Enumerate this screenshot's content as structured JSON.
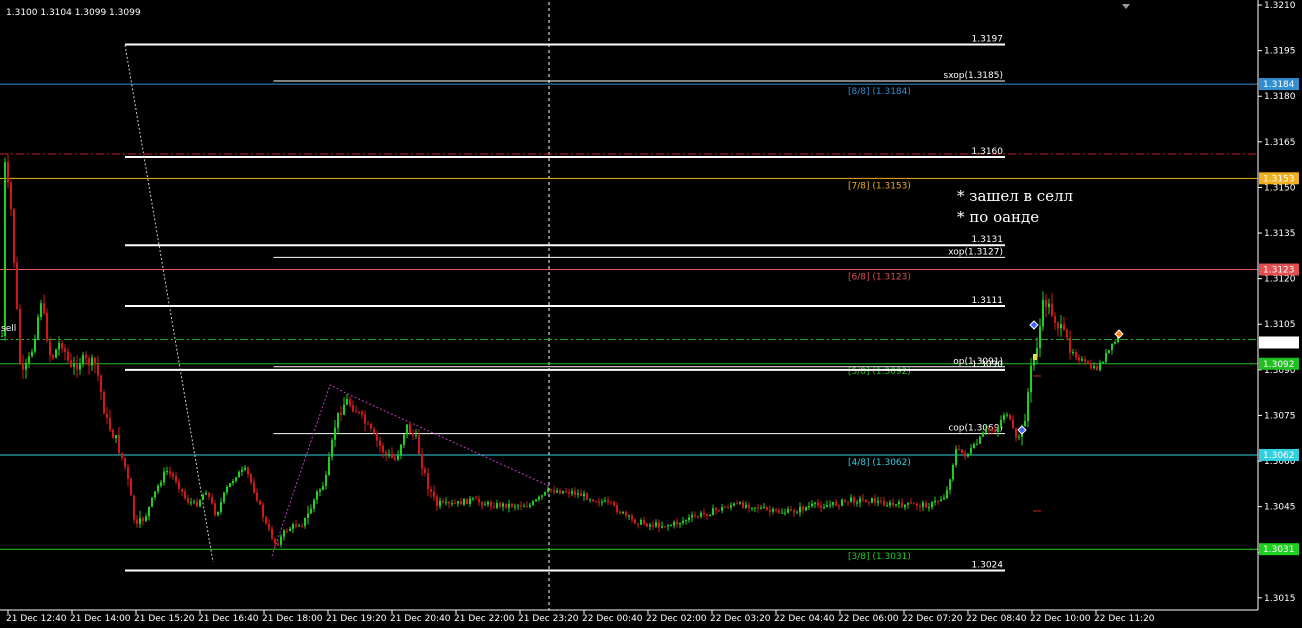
{
  "header": {
    "ohlc": "1.3100 1.3104 1.3099 1.3099"
  },
  "sell_label": "sell",
  "note": {
    "line1": "* зашел в селл",
    "line2": "* по оанде"
  },
  "price_axis": {
    "min": 1.3011,
    "max": 1.3211,
    "ticks": [
      "1.3210",
      "1.3195",
      "1.3180",
      "1.3165",
      "1.3150",
      "1.3135",
      "1.3120",
      "1.3105",
      "1.3090",
      "1.3075",
      "1.3060",
      "1.3045",
      "1.3030",
      "1.3015"
    ],
    "tick_values": [
      1.321,
      1.3195,
      1.318,
      1.3165,
      1.315,
      1.3135,
      1.312,
      1.3105,
      1.309,
      1.3075,
      1.306,
      1.3045,
      1.303,
      1.3015
    ]
  },
  "time_axis": {
    "labels": [
      "21 Dec 12:40",
      "21 Dec 14:00",
      "21 Dec 15:20",
      "21 Dec 16:40",
      "21 Dec 18:00",
      "21 Dec 19:20",
      "21 Dec 20:40",
      "21 Dec 22:00",
      "21 Dec 23:20",
      "22 Dec 00:40",
      "22 Dec 02:00",
      "22 Dec 03:20",
      "22 Dec 04:40",
      "22 Dec 06:00",
      "22 Dec 07:20",
      "22 Dec 08:40",
      "22 Dec 10:00",
      "22 Dec 11:20"
    ]
  },
  "murrey_levels": [
    {
      "id": "8-8",
      "label": "[8/8]  (1.3184)",
      "price": 1.3184,
      "color": "#2f8fd0",
      "badge": "1.3184",
      "badge_text_color": "#000000"
    },
    {
      "id": "7-8",
      "label": "[7/8]  (1.3153)",
      "price": 1.3153,
      "color": "#f0b020",
      "badge": "1.3153",
      "badge_text_color": "#000000"
    },
    {
      "id": "6-8",
      "label": "[6/8]  (1.3123)",
      "price": 1.3123,
      "color": "#e05050",
      "badge": "1.3123",
      "badge_text_color": "#ffffff"
    },
    {
      "id": "5-8",
      "label": "[5/8]  (1.3092)",
      "price": 1.3092,
      "color": "#20c020",
      "badge": "1.3092",
      "badge_text_color": "#000000"
    },
    {
      "id": "4-8",
      "label": "[4/8]  (1.3062)",
      "price": 1.3062,
      "color": "#30d0e0",
      "badge": "1.3062",
      "badge_text_color": "#000000"
    },
    {
      "id": "3-8",
      "label": "[3/8]  (1.3031)",
      "price": 1.3031,
      "color": "#20d020",
      "badge": "1.3031",
      "badge_text_color": "#000000"
    }
  ],
  "white_levels": [
    {
      "label": "1.3197",
      "price": 1.3197,
      "start": 0.096,
      "thick": true
    },
    {
      "label": "sxop(1.3185)",
      "price": 1.3185,
      "start": 0.21,
      "thick": false
    },
    {
      "label": "1.3160",
      "price": 1.316,
      "start": 0.096,
      "thick": true
    },
    {
      "label": "1.3131",
      "price": 1.3131,
      "start": 0.096,
      "thick": true
    },
    {
      "label": "xop(1.3127)",
      "price": 1.3127,
      "start": 0.21,
      "thick": false
    },
    {
      "label": "1.3111",
      "price": 1.3111,
      "start": 0.096,
      "thick": true
    },
    {
      "label": "op(1.3091)",
      "price": 1.3091,
      "start": 0.21,
      "thick": false
    },
    {
      "label": "1.3090",
      "price": 1.309,
      "start": 0.096,
      "thick": true
    },
    {
      "label": "cop(1.3069)",
      "price": 1.3069,
      "start": 0.21,
      "thick": false
    },
    {
      "label": "1.3024",
      "price": 1.3024,
      "start": 0.096,
      "thick": true
    }
  ],
  "dashed_levels": [
    {
      "price": 1.3161,
      "color": "#d02020"
    },
    {
      "price": 1.31,
      "color": "#20b020"
    }
  ],
  "current_price": {
    "value": 1.3099,
    "badge": "1.3099"
  },
  "colors": {
    "bull": "#20d020",
    "bear": "#d01818",
    "grid": "#ffffff"
  }
}
